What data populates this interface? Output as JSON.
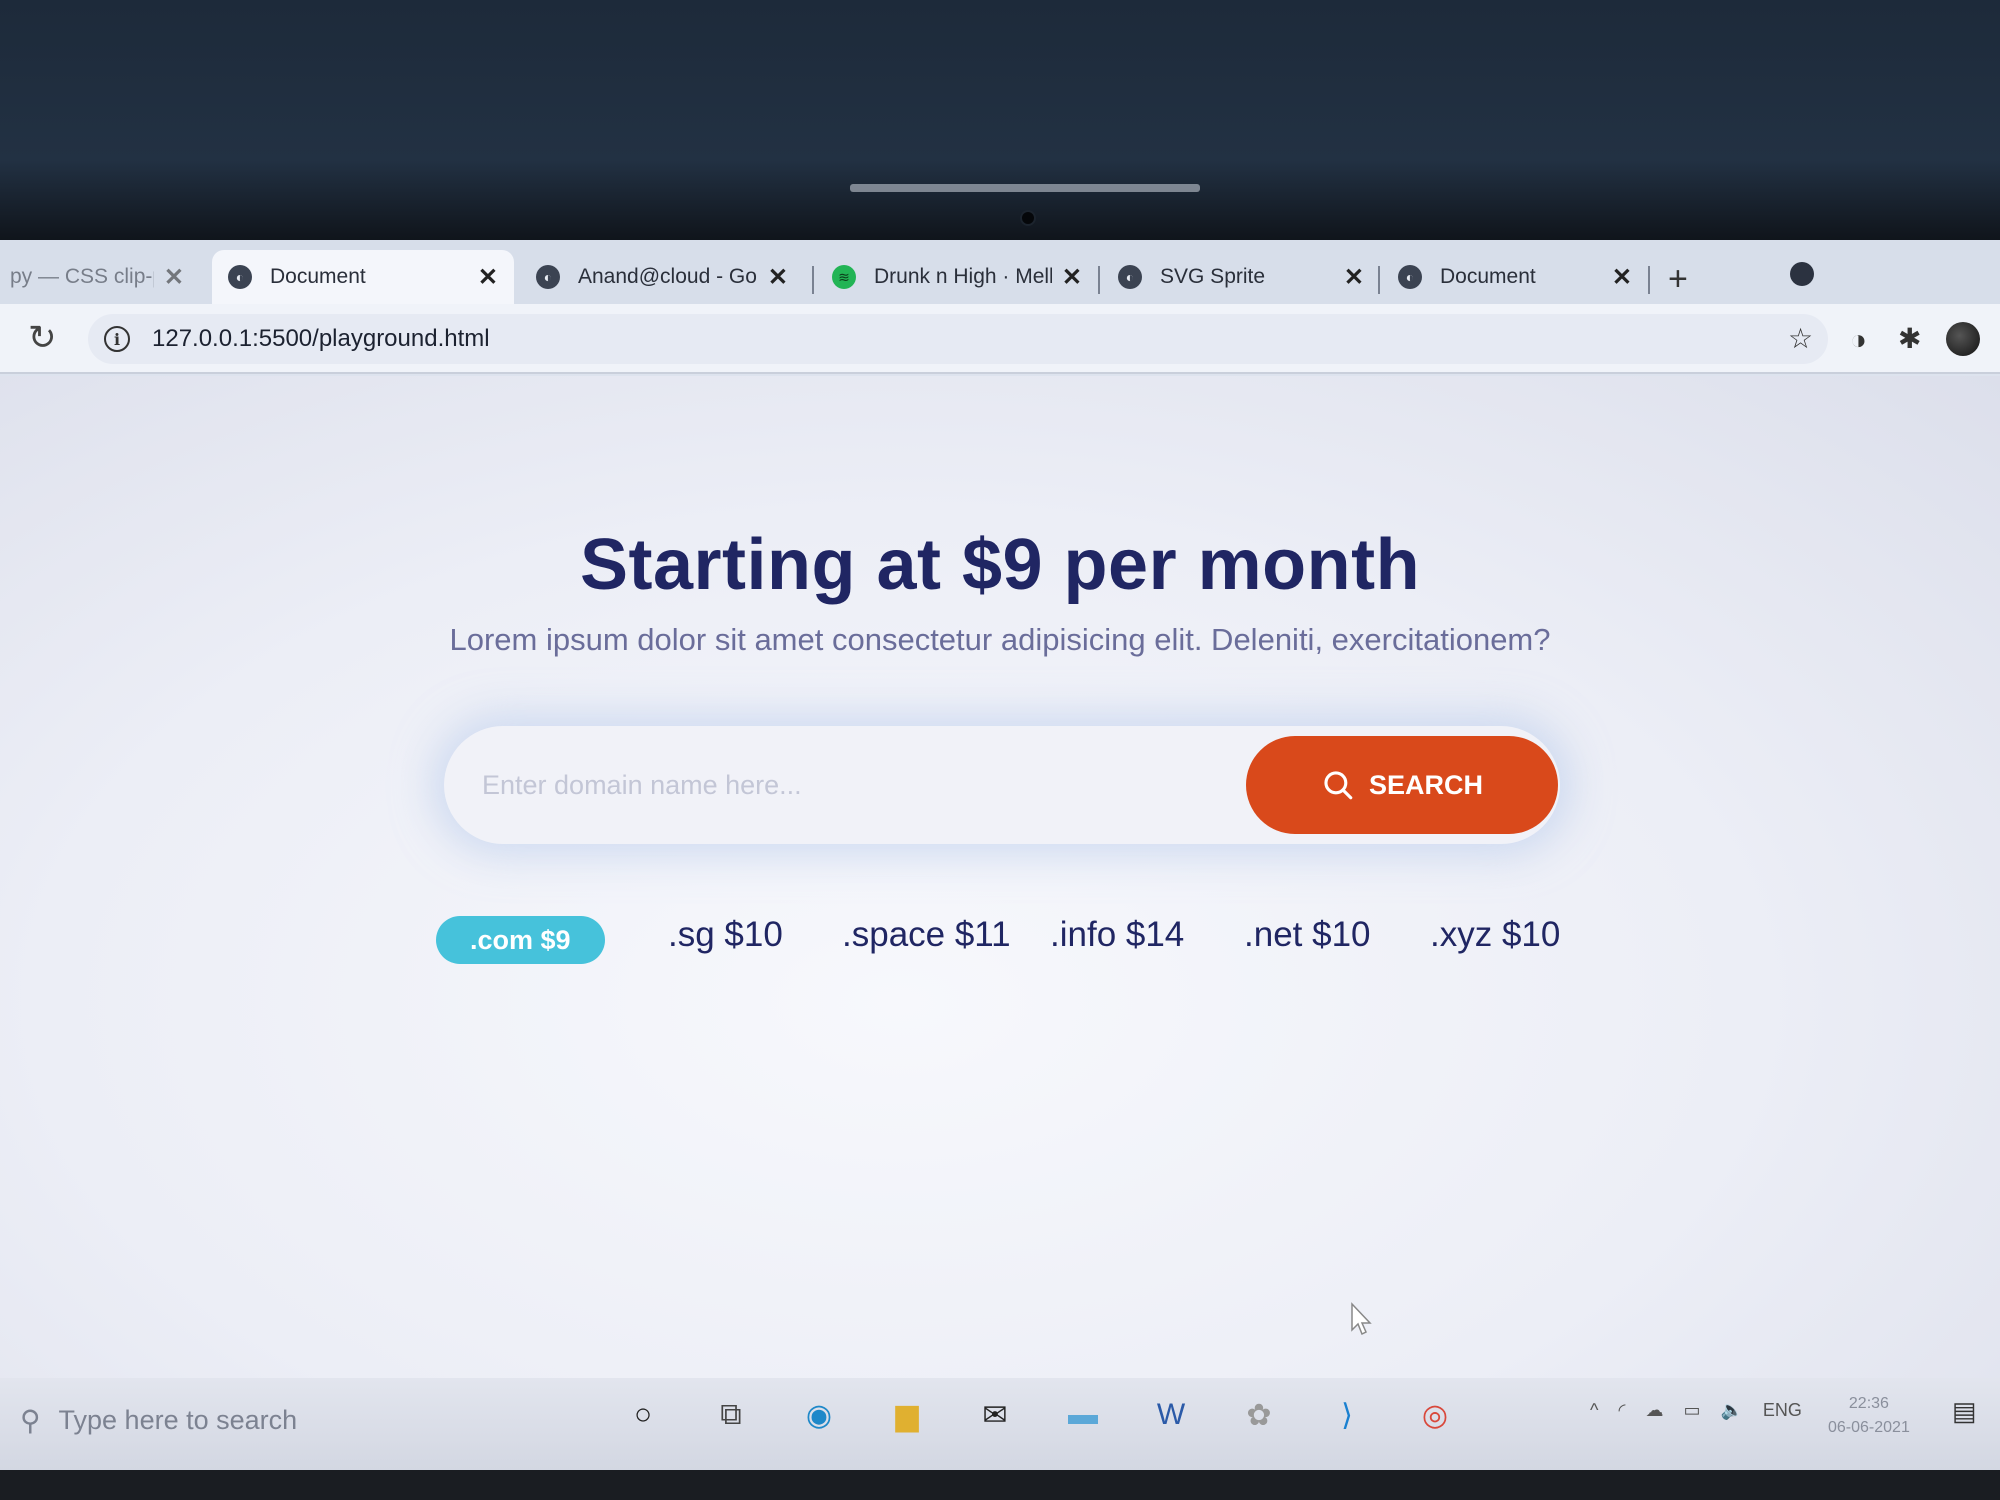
{
  "browser": {
    "tabs": [
      {
        "label": "py — CSS clip-p",
        "favicon": "none"
      },
      {
        "label": "Document",
        "favicon": "globe-icon",
        "active": true
      },
      {
        "label": "Anand@cloud - Go",
        "favicon": "globe-icon"
      },
      {
        "label": "Drunk n High · Mell",
        "favicon": "spotify-icon"
      },
      {
        "label": "SVG Sprite",
        "favicon": "globe-icon"
      },
      {
        "label": "Document",
        "favicon": "globe-icon"
      }
    ],
    "url": "127.0.0.1:5500/playground.html"
  },
  "page": {
    "headline": "Starting at $9 per month",
    "subline": "Lorem ipsum dolor sit amet consectetur adipisicing elit. Deleniti, exercitationem?",
    "search": {
      "placeholder": "Enter domain name here...",
      "button_label": "SEARCH"
    },
    "tlds": [
      {
        "label": ".com $9",
        "active": true
      },
      {
        "label": ".sg $10"
      },
      {
        "label": ".space $11"
      },
      {
        "label": ".info $14"
      },
      {
        "label": ".net $10"
      },
      {
        "label": ".xyz $10"
      }
    ]
  },
  "taskbar": {
    "search_placeholder": "Type here to search",
    "language": "ENG",
    "time": "22:36",
    "date": "06-06-2021"
  },
  "colors": {
    "headline": "#202663",
    "search_button": "#d9491b",
    "tld_active": "#46c2db"
  }
}
